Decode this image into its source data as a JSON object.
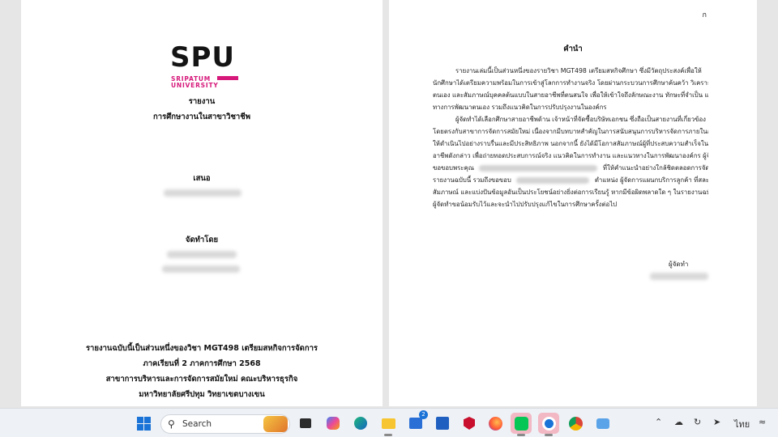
{
  "left_page": {
    "logo": {
      "text": "SPU",
      "line1": "SRIPATUM",
      "line2": "UNIVERSITY",
      "brand_color": "#d6187a"
    },
    "title1": "รายงาน",
    "title2": "การศึกษางานในสาขาวิชาชีพ",
    "submit_label": "เสนอ",
    "prepared_label": "จัดทำโดย",
    "footer_lines": [
      "รายงานฉบับนี้เป็นส่วนหนึ่งของวิชา MGT498 เตรียมสหกิจการจัดการ",
      "ภาคเรียนที่ 2 ภาคการศึกษา 2568",
      "สาขาการบริหารและการจัดการสมัยใหม่ คณะบริหารธุรกิจ",
      "มหาวิทยาลัยศรีปทุม วิทยาเขตบางเขน"
    ]
  },
  "right_page": {
    "page_number": "ก",
    "title": "คำนำ",
    "paragraph1": [
      "รายงานเล่มนี้เป็นส่วนหนึ่งของรายวิชา MGT498 เตรียมสหกิจศึกษา ซึ่งมีวัตถุประสงค์เพื่อให้",
      "นักศึกษาได้เตรียมความพร้อมในการเข้าสู่โลกการทำงานจริง โดยผ่านกระบวนการศึกษาค้นคว้า วิเคราะห์",
      "ตนเอง และสัมภาษณ์บุคคลต้นแบบในสายอาชีพที่ตนสนใจ เพื่อให้เข้าใจถึงลักษณะงาน ทักษะที่จำเป็น แนว",
      "ทางการพัฒนาตนเอง รวมถึงแนวคิดในการปรับปรุงงานในองค์กร"
    ],
    "paragraph2": [
      "ผู้จัดทำได้เลือกศึกษาสายอาชีพด้าน เจ้าหน้าที่จัดซื้อบริษัทเอกชน ซึ่งถือเป็นสายงานที่เกี่ยวข้อง",
      "โดยตรงกับสาขาการจัดการสมัยใหม่ เนื่องจากมีบทบาทสำคัญในการสนับสนุนการบริหารจัดการภายในองค์กร",
      "ให้ดำเนินไปอย่างราบรื่นและมีประสิทธิภาพ นอกจากนี้ ยังได้มีโอกาสสัมภาษณ์ผู้ที่ประสบความสำเร็จในสาย",
      "อาชีพดังกล่าว เพื่อถ่ายทอดประสบการณ์จริง แนวคิดในการทำงาน และแนวทางในการพัฒนาองค์กร ผู้จัดทำ",
      "ขอขอบพระคุณ",
      "ที่ให้คำแนะนำอย่างใกล้ชิดตลอดการจัดทำ",
      "รายงานฉบับนี้ รวมถึงขอขอบ",
      "ตำแหน่ง ผู้จัดการแผนกบริการลูกค้า ที่สละเวลาให้",
      "สัมภาษณ์ และแบ่งปันข้อมูลอันเป็นประโยชน์อย่างยิ่งต่อการเรียนรู้ หากมีข้อผิดพลาดใด ๆ ในรายงานฉบับนี้",
      "ผู้จัดทำขอน้อมรับไว้และจะนำไปปรับปรุงแก้ไขในการศึกษาครั้งต่อไป"
    ],
    "signer_label": "ผู้จัดทำ"
  },
  "taskbar": {
    "search_placeholder": "Search",
    "store_badge": "2",
    "tray_lang": "ไทย",
    "icons": [
      "windows-start-icon",
      "search-icon",
      "task-view-icon",
      "copilot-icon",
      "edge-icon",
      "file-explorer-icon",
      "store-icon",
      "app-icon",
      "mcafee-icon",
      "firefox-icon",
      "line-icon",
      "app-highlighted-icon",
      "chrome-icon",
      "onedrive-folder-icon"
    ],
    "accent_color": "#1a73d6",
    "highlight_color": "#f2b8c3"
  }
}
